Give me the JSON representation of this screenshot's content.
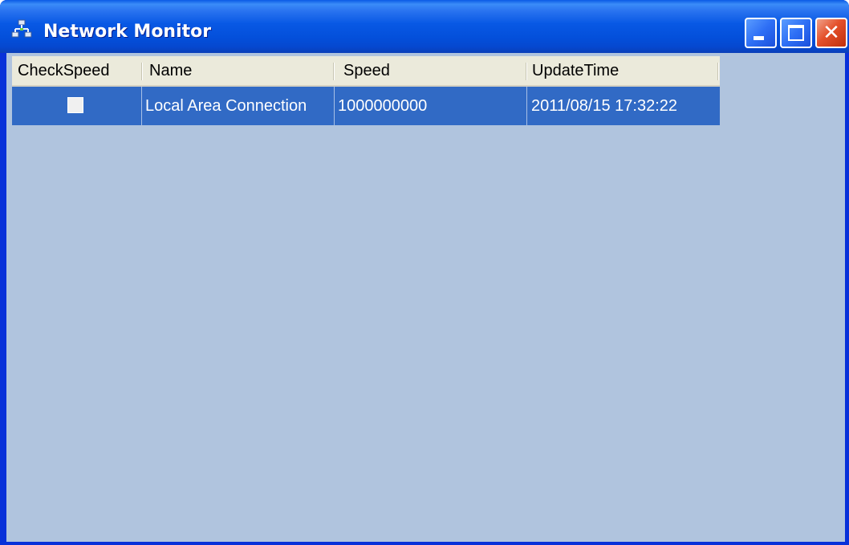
{
  "window": {
    "title": "Network Monitor",
    "icon": "network-icon"
  },
  "titlebar_buttons": {
    "minimize_icon": "minimize-icon",
    "maximize_icon": "maximize-icon",
    "close_icon": "close-icon",
    "close_glyph": "✕"
  },
  "grid": {
    "columns": [
      "CheckSpeed",
      "Name",
      "Speed",
      "UpdateTime"
    ],
    "rows": [
      {
        "check_speed": false,
        "name": "Local Area Connection",
        "speed": "1000000000",
        "update_time": "2011/08/15 17:32:22"
      }
    ]
  },
  "colors": {
    "selection": "#316ac5",
    "client_background": "#b0c4de",
    "titlebar": "#0858e4"
  }
}
